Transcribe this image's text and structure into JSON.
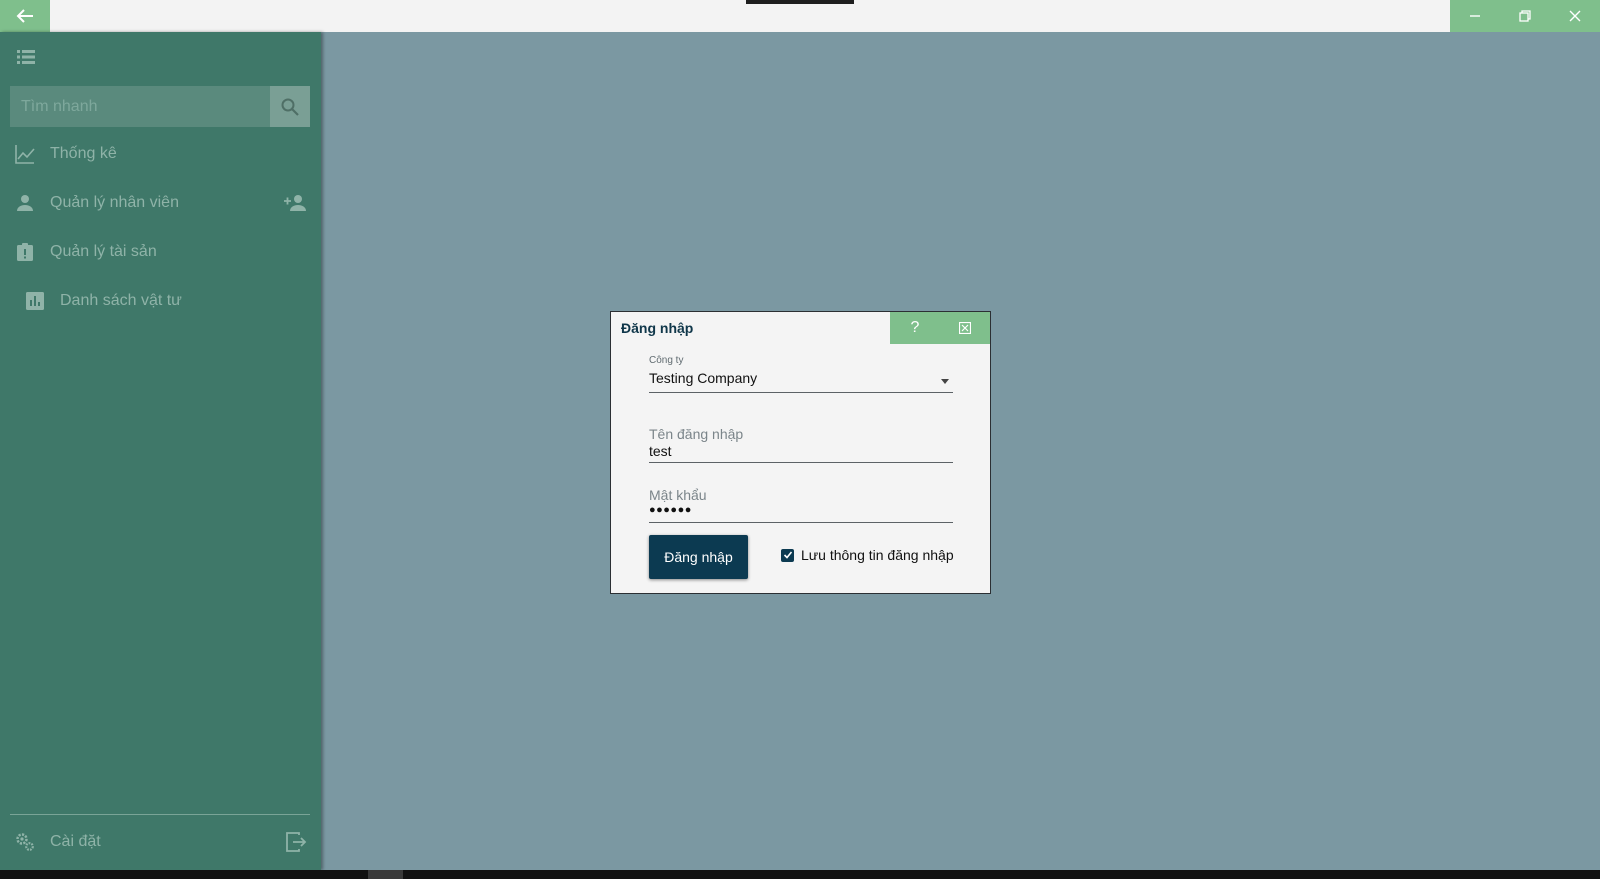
{
  "titlebar": {
    "back_icon": "arrow-left-icon",
    "minimize_icon": "minimize-icon",
    "restore_icon": "restore-icon",
    "close_icon": "close-icon"
  },
  "sidebar": {
    "search": {
      "placeholder": "Tìm nhanh",
      "icon": "search-icon"
    },
    "items": [
      {
        "label": "Thống kê",
        "icon": "line-chart-icon"
      },
      {
        "label": "Quản lý nhân viên",
        "icon": "person-icon",
        "action_icon": "add-person-icon"
      },
      {
        "label": "Quản lý tài sản",
        "icon": "clipboard-alert-icon"
      },
      {
        "label": "Danh sách vật tư",
        "icon": "bar-chart-icon"
      }
    ],
    "settings": {
      "label": "Cài đặt",
      "icon": "gears-icon"
    },
    "logout_icon": "logout-icon"
  },
  "dialog": {
    "title": "Đăng nhập",
    "help_label": "?",
    "company": {
      "label": "Công ty",
      "value": "Testing Company"
    },
    "username": {
      "label": "Tên đăng nhập",
      "value": "test"
    },
    "password": {
      "label": "Mật khẩu",
      "value": "●●●●●●"
    },
    "login_button": "Đăng nhập",
    "remember": {
      "label": "Lưu thông tin đăng nhập",
      "checked": true
    }
  },
  "colors": {
    "accent": "#7fbf8c",
    "sidebar": "#3f7869",
    "background": "#7b98a2",
    "primary_button": "#0c3a51"
  }
}
